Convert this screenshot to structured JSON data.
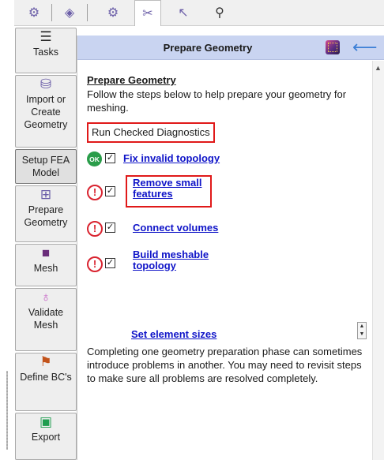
{
  "toolbar": {
    "tabs": [
      {
        "name": "geometry-tools-icon",
        "glyph": "⚙"
      },
      {
        "name": "volume-tools-icon",
        "glyph": "◈"
      },
      {
        "name": "mesh-quality-icon",
        "glyph": "⚙"
      },
      {
        "name": "prepare-tools-icon",
        "glyph": "✂"
      },
      {
        "name": "cursor-pick-icon",
        "glyph": "↖"
      },
      {
        "name": "search-icon",
        "glyph": "⚲"
      }
    ],
    "active_index": 3
  },
  "nav": {
    "items": [
      {
        "id": "tasks",
        "label": "Tasks",
        "icon": "list-icon",
        "glyph": "☰"
      },
      {
        "id": "import",
        "label": "Import or Create Geometry",
        "icon": "import-geometry-icon",
        "glyph": "⛁"
      },
      {
        "id": "setup-fea",
        "label": "Setup FEA Model",
        "icon": "",
        "glyph": ""
      },
      {
        "id": "prepare",
        "label": "Prepare Geometry",
        "icon": "prepare-geometry-icon",
        "glyph": "⊞"
      },
      {
        "id": "mesh",
        "label": "Mesh",
        "icon": "mesh-cube-icon",
        "glyph": "■"
      },
      {
        "id": "validate",
        "label": "Validate Mesh",
        "icon": "ribbon-icon",
        "glyph": "♁"
      },
      {
        "id": "define-bcs",
        "label": "Define BC's",
        "icon": "boundary-condition-icon",
        "glyph": "⚑"
      },
      {
        "id": "export",
        "label": "Export",
        "icon": "save-icon",
        "glyph": "▣"
      }
    ],
    "selected": "setup-fea"
  },
  "panel": {
    "title": "Prepare Geometry",
    "heading": "Prepare Geometry",
    "intro": "Follow the steps below to help prepare your geometry for meshing.",
    "diagnostics_label": "Run Checked Diagnostics",
    "steps": [
      {
        "status": "ok",
        "status_text": "OK",
        "checked": "✓",
        "label": "Fix invalid topology"
      },
      {
        "status": "warn",
        "status_text": "!",
        "checked": "✓",
        "label": "Remove small features"
      },
      {
        "status": "warn",
        "status_text": "!",
        "checked": "✓",
        "label": "Connect volumes"
      },
      {
        "status": "warn",
        "status_text": "!",
        "checked": "✓",
        "label": "Build meshable topology"
      }
    ],
    "set_sizes_label": "Set element sizes",
    "outro": "Completing one geometry preparation phase can sometimes introduce problems in another. You may need to revisit steps to make sure all problems are resolved completely."
  },
  "colors": {
    "header_bg": "#c9d4f1",
    "link": "#0f14c8",
    "highlight_box": "#e01919",
    "ok_green": "#2a9d4a",
    "warn_red": "#d9232f"
  }
}
